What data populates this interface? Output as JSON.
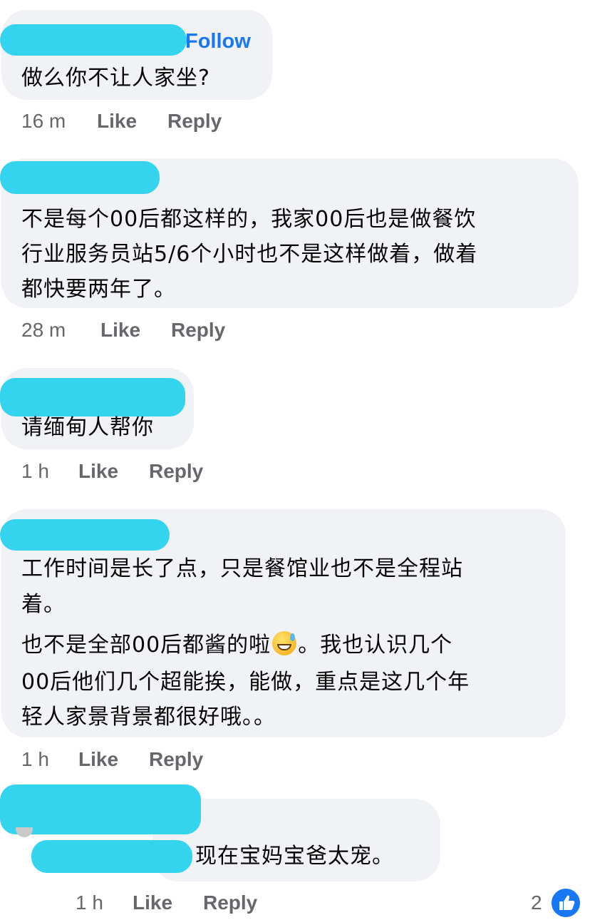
{
  "comments": [
    {
      "follow": "Follow",
      "lines": [
        "做么你不让人家坐?"
      ],
      "time": "16 m",
      "like": "Like",
      "reply": "Reply"
    },
    {
      "lines": [
        "不是每个00后都这样的，我家00后也是做餐饮",
        "行业服务员站5/6个小时也不是这样做着，做着",
        "都快要两年了。"
      ],
      "time": "28 m",
      "like": "Like",
      "reply": "Reply"
    },
    {
      "lines": [
        "请缅甸人帮你"
      ],
      "time": "1 h",
      "like": "Like",
      "reply": "Reply"
    },
    {
      "lines": [
        "工作时间是长了点，只是餐馆业也不是全程站",
        "着。"
      ],
      "lines2_pre": "也不是全部00后都酱的啦",
      "lines2_post": "。我也认识几个",
      "lines3": [
        "00后他们几个超能挨，能做，重点是这几个年",
        "轻人家景背景都很好哦。。"
      ],
      "emoji": "grinning-sweat-emoji",
      "time": "1 h",
      "like": "Like",
      "reply": "Reply"
    },
    {
      "lines": [
        "现在宝妈宝爸太宠。"
      ],
      "time": "1 h",
      "like": "Like",
      "reply": "Reply",
      "reaction_count": "2",
      "reaction_icon": "thumbs-up-icon"
    }
  ],
  "colors": {
    "link": "#1877f2",
    "bubble": "#f0f2f5",
    "meta": "#65676b",
    "redaction": "#35d4ee"
  }
}
